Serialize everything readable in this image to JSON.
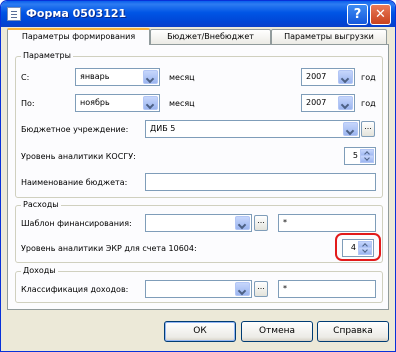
{
  "window": {
    "title": "Форма 0503121",
    "help_glyph": "?",
    "close_glyph": "✕"
  },
  "tabs": [
    {
      "label": "Параметры формирования",
      "active": true
    },
    {
      "label": "Бюджет/Внебюджет",
      "active": false
    },
    {
      "label": "Параметры выгрузки",
      "active": false
    }
  ],
  "parameters": {
    "legend": "Параметры",
    "from_label": "С:",
    "from_month": "январь",
    "from_month_suffix": "месяц",
    "from_year": "2007",
    "from_year_suffix": "год",
    "to_label": "По:",
    "to_month": "ноябрь",
    "to_month_suffix": "месяц",
    "to_year": "2007",
    "to_year_suffix": "год",
    "institution_label": "Бюджетное учреждение:",
    "institution_value": "ДИБ 5",
    "kosgu_level_label": "Уровень аналитики КОСГУ:",
    "kosgu_level_value": "5",
    "budget_name_label": "Наименование бюджета:",
    "budget_name_value": ""
  },
  "expenses": {
    "legend": "Расходы",
    "template_label": "Шаблон финансирования:",
    "template_value": "",
    "template_extra": "*",
    "ekr_level_label": "Уровень аналитики ЭКР для счета 10604:",
    "ekr_level_value": "4"
  },
  "incomes": {
    "legend": "Доходы",
    "classification_label": "Классификация доходов:",
    "classification_value": "",
    "classification_extra": "*"
  },
  "ellipsis": "...",
  "buttons": {
    "ok": "ОК",
    "cancel": "Отмена",
    "help": "Справка"
  },
  "colors": {
    "title_bar": "#0055e5",
    "dialog_bg": "#ece9d8",
    "highlight": "#e21b1b"
  }
}
